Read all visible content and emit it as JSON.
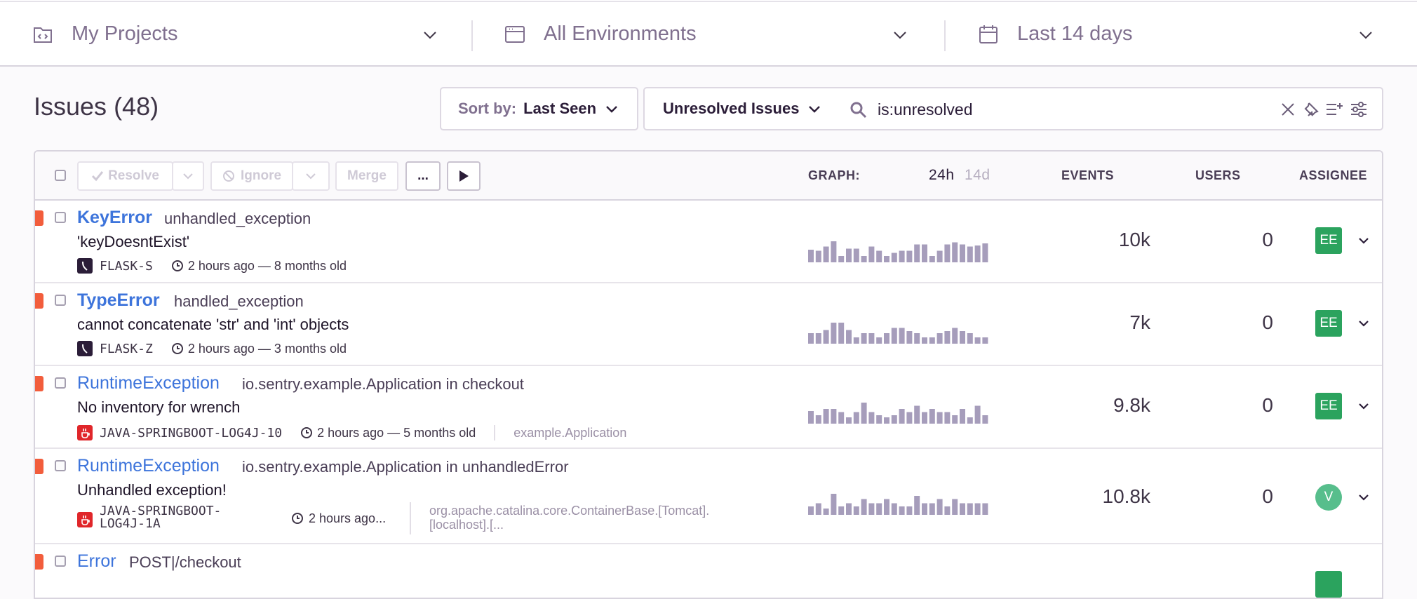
{
  "filters": {
    "project": {
      "label": "My Projects",
      "icon": "project-icon"
    },
    "environment": {
      "label": "All Environments",
      "icon": "environment-icon"
    },
    "period": {
      "label": "Last 14 days",
      "icon": "calendar-icon"
    }
  },
  "header": {
    "title": "Issues",
    "count": "(48)"
  },
  "sort": {
    "key_label": "Sort by:",
    "value": "Last Seen"
  },
  "saved_search": {
    "label": "Unresolved Issues"
  },
  "search": {
    "query": "is:unresolved"
  },
  "actions": {
    "resolve": "Resolve",
    "ignore": "Ignore",
    "merge": "Merge",
    "more": "..."
  },
  "columns": {
    "graph": "GRAPH:",
    "period_24h": "24h",
    "period_14d": "14d",
    "events": "EVENTS",
    "users": "USERS",
    "assignee": "ASSIGNEE"
  },
  "colors": {
    "accent": "#3d74db",
    "level_error": "#f25d3c",
    "assignee_green": "#2ba35e",
    "avatar_light_green": "#57be8c",
    "graph_bar": "#a69dbb"
  },
  "issues": [
    {
      "type": "KeyError",
      "culprit": "unhandled_exception",
      "message": "'keyDoesntExist'",
      "platform": "flask",
      "short_id": "FLASK-S",
      "age": "2 hours ago — 8 months old",
      "location": "",
      "events": "10k",
      "users": "0",
      "assignee": "EE",
      "assignee_style": "square",
      "graph": [
        0.6,
        0.55,
        0.75,
        1.0,
        0.3,
        0.65,
        0.65,
        0.3,
        0.75,
        0.55,
        0.3,
        0.45,
        0.55,
        0.55,
        0.85,
        0.85,
        0.3,
        0.55,
        0.85,
        0.95,
        0.85,
        0.75,
        0.8,
        0.9
      ]
    },
    {
      "type": "TypeError",
      "culprit": "handled_exception",
      "message": "cannot concatenate 'str' and 'int' objects",
      "platform": "flask",
      "short_id": "FLASK-Z",
      "age": "2 hours ago — 3 months old",
      "location": "",
      "events": "7k",
      "users": "0",
      "assignee": "EE",
      "assignee_style": "square",
      "graph": [
        0.5,
        0.5,
        0.65,
        1.0,
        1.0,
        0.65,
        0.3,
        0.5,
        0.5,
        0.3,
        0.5,
        0.75,
        0.75,
        0.6,
        0.5,
        0.3,
        0.3,
        0.5,
        0.6,
        0.75,
        0.6,
        0.5,
        0.3,
        0.3
      ]
    },
    {
      "type": "RuntimeException",
      "culprit": "io.sentry.example.Application in checkout",
      "message": "No inventory for wrench",
      "platform": "java",
      "short_id": "JAVA-SPRINGBOOT-LOG4J-10",
      "age": "2 hours ago — 5 months old",
      "location": "example.Application",
      "events": "9.8k",
      "users": "0",
      "assignee": "EE",
      "assignee_style": "square",
      "graph": [
        0.6,
        0.4,
        0.7,
        0.7,
        0.55,
        0.3,
        0.55,
        1.0,
        0.55,
        0.4,
        0.3,
        0.4,
        0.7,
        0.55,
        0.85,
        0.55,
        0.7,
        0.55,
        0.55,
        0.4,
        0.7,
        0.3,
        0.85,
        0.4
      ]
    },
    {
      "type": "RuntimeException",
      "culprit": "io.sentry.example.Application in unhandledError",
      "message": "Unhandled exception!",
      "platform": "java",
      "short_id": "JAVA-SPRINGBOOT-LOG4J-1A",
      "age": "2 hours ago...",
      "location": "org.apache.catalina.core.ContainerBase.[Tomcat].[localhost].[...",
      "events": "10.8k",
      "users": "0",
      "assignee": "V",
      "assignee_style": "circle",
      "graph": [
        0.4,
        0.55,
        0.3,
        1.0,
        0.4,
        0.55,
        0.4,
        0.75,
        0.55,
        0.55,
        0.75,
        0.55,
        0.4,
        0.4,
        0.9,
        0.55,
        0.55,
        0.75,
        0.4,
        0.75,
        0.55,
        0.55,
        0.55,
        0.55
      ]
    },
    {
      "type": "Error",
      "culprit": "POST|/checkout",
      "message": "",
      "platform": "",
      "short_id": "",
      "age": "",
      "location": "",
      "events": "",
      "users": "",
      "assignee": "",
      "assignee_style": "square",
      "graph": []
    }
  ]
}
